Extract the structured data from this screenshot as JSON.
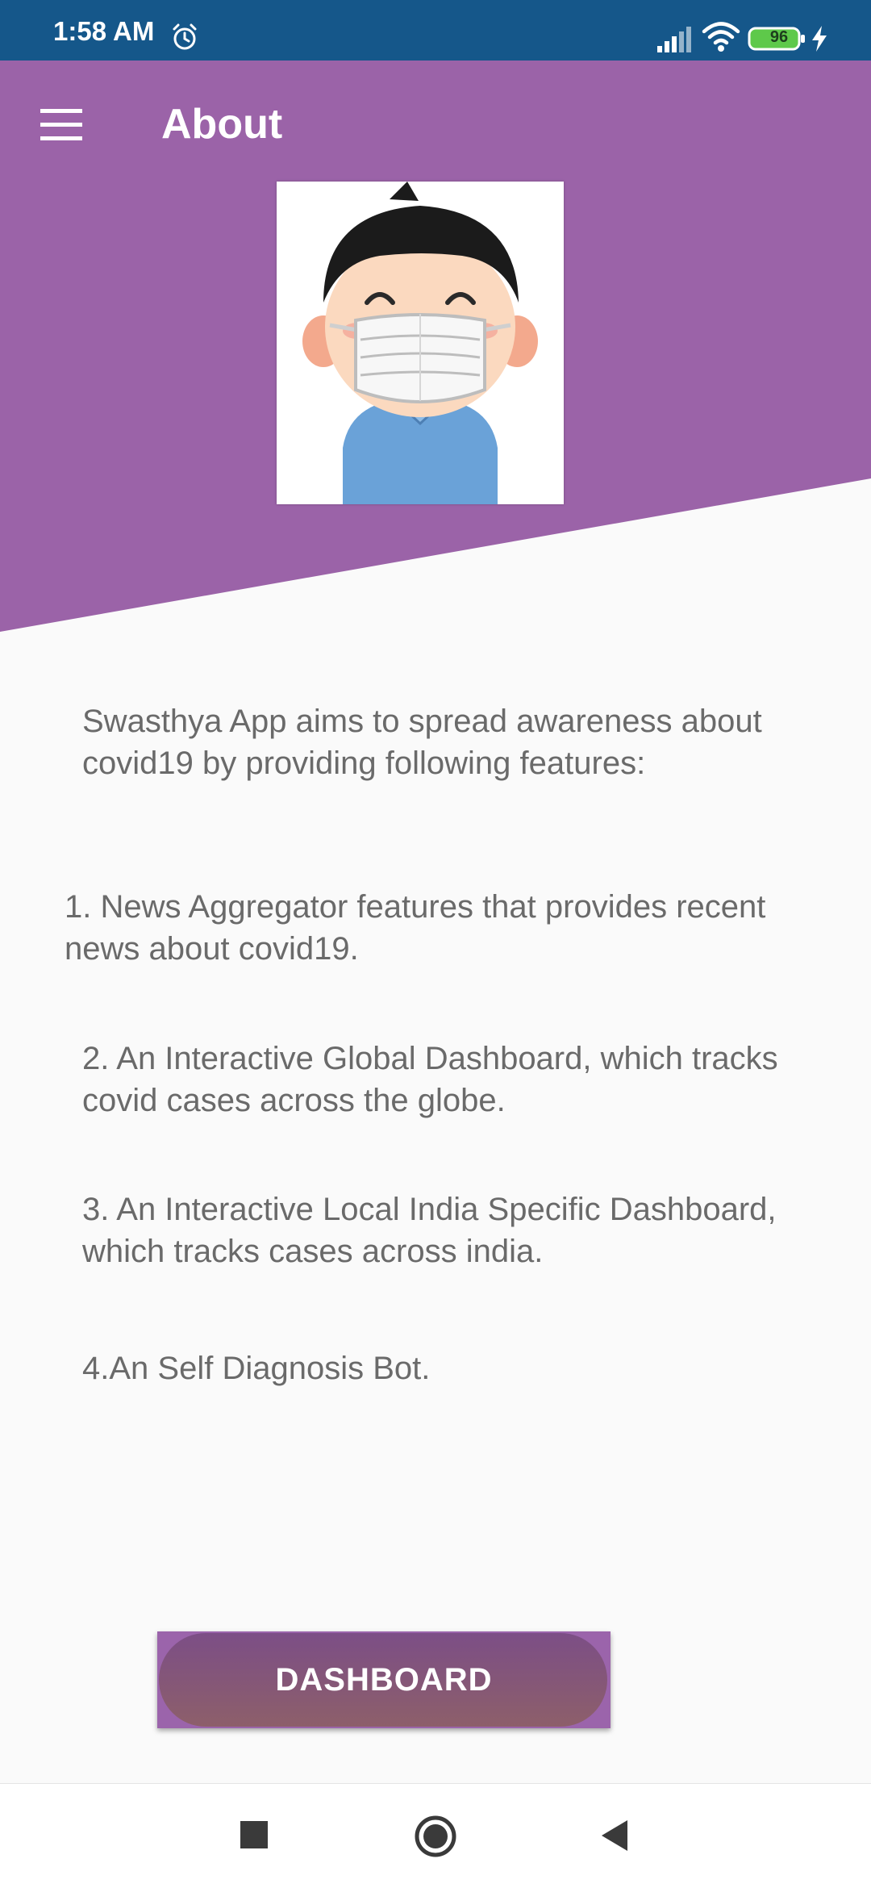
{
  "status_bar": {
    "time": "1:58 AM",
    "battery_level": "96",
    "icons": [
      "alarm-icon",
      "signal-icon",
      "wifi-icon",
      "battery-icon",
      "charging-icon"
    ]
  },
  "header": {
    "title": "About",
    "menu_icon": "hamburger-menu-icon",
    "color": "#9b63a8"
  },
  "avatar": {
    "icon": "masked-person-icon"
  },
  "content": {
    "intro": " Swasthya App aims to spread awareness about covid19 by providing following features:",
    "features": [
      "1. News Aggregator features that provides recent news about covid19.",
      "2. An Interactive Global Dashboard, which tracks covid cases across the globe.",
      "3. An Interactive Local India Specific Dashboard, which tracks cases across india.",
      "4.An Self Diagnosis Bot."
    ]
  },
  "dashboard_button": {
    "label": "DASHBOARD"
  },
  "nav_bar": {
    "icons": [
      "recents-square-icon",
      "home-circle-icon",
      "back-triangle-icon"
    ]
  },
  "colors": {
    "status_bar": "#15578a",
    "header": "#9b63a8",
    "background": "#fafafa",
    "text": "#6a6a6a"
  }
}
